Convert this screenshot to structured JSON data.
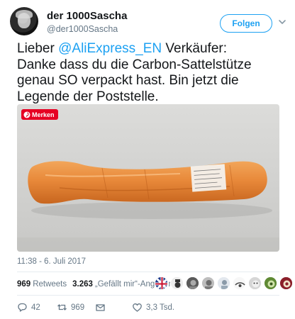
{
  "user": {
    "display_name": "der 1000Sascha",
    "handle": "@der1000Sascha",
    "avatar_icon": "profile-photo"
  },
  "header": {
    "follow_label": "Folgen",
    "more_icon": "chevron-down-icon"
  },
  "tweet": {
    "line1_prefix": "Lieber ",
    "mention": "@AliExpress_EN",
    "line1_suffix": " Verkäufer:",
    "line2": "Danke dass du die Carbon-Sattelstütze",
    "line3": "genau SO verpackt hast. Bin jetzt die",
    "line4": "Legende der Poststelle."
  },
  "media": {
    "pin_label": "Merken",
    "pin_color": "#e60023",
    "parcel_color": "#e8893a"
  },
  "timestamp": "11:38 - 6. Juli 2017",
  "stats": {
    "retweets_count": "969",
    "retweets_label": "Retweets",
    "likes_count": "3.263",
    "likes_label": "„Gefällt mir“-Angaben"
  },
  "actions": {
    "reply_count": "42",
    "retweet_count": "969",
    "like_count": "3,3 Tsd."
  },
  "colors": {
    "accent": "#1da1f2",
    "text": "#14171a",
    "muted": "#657786"
  }
}
